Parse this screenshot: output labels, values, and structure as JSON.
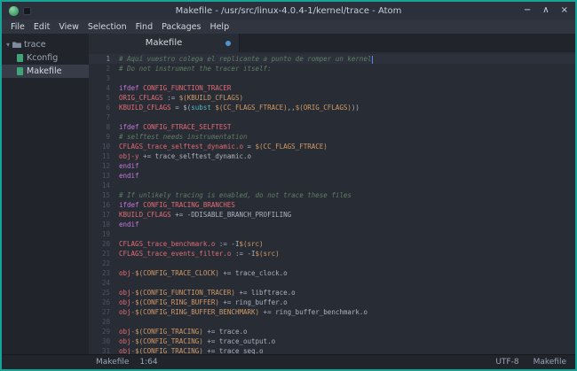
{
  "window": {
    "title": "Makefile - /usr/src/linux-4.0.4-1/kernel/trace - Atom",
    "controls": [
      {
        "name": "minimize",
        "glyph": "−"
      },
      {
        "name": "maximize",
        "glyph": "∧"
      },
      {
        "name": "close",
        "glyph": "×"
      }
    ]
  },
  "menu": {
    "items": [
      "File",
      "Edit",
      "View",
      "Selection",
      "Find",
      "Packages",
      "Help"
    ]
  },
  "sidebar": {
    "root": "trace",
    "files": [
      "Kconfig",
      "Makefile"
    ],
    "active_file": "Makefile"
  },
  "tabs": [
    {
      "label": "Makefile",
      "modified": true
    }
  ],
  "statusbar": {
    "file": "Makefile",
    "position": "1:64",
    "encoding": "UTF-8",
    "grammar": "Makefile"
  },
  "colors": {
    "frame": "#17a398",
    "editor_bg": "#282c34",
    "panel_bg": "#21252b",
    "comment": "#5f7e63",
    "keyword": "#c678dd",
    "variable": "#e06c75",
    "interpolation": "#d19a66",
    "function": "#56b6c2",
    "text": "#abb2bf",
    "modified_dot": "#5294cf",
    "file_icon": "#3fa478"
  },
  "editor": {
    "lines": [
      {
        "n": 1,
        "cursor": true,
        "t": [
          [
            "cmt",
            "# Aquí vuestro colega el replicante a punto de romper un kernel"
          ]
        ]
      },
      {
        "n": 2,
        "t": [
          [
            "cmt",
            "# Do not instrument the tracer itself:"
          ]
        ]
      },
      {
        "n": 3,
        "t": []
      },
      {
        "n": 4,
        "t": [
          [
            "kw",
            "ifdef"
          ],
          [
            "txt",
            " "
          ],
          [
            "var",
            "CONFIG_FUNCTION_TRACER"
          ]
        ]
      },
      {
        "n": 5,
        "t": [
          [
            "var",
            "ORIG_CFLAGS"
          ],
          [
            "txt",
            " := "
          ],
          [
            "interp",
            "$(KBUILD_CFLAGS)"
          ]
        ]
      },
      {
        "n": 6,
        "t": [
          [
            "var",
            "KBUILD_CFLAGS"
          ],
          [
            "txt",
            " = $("
          ],
          [
            "fn",
            "subst"
          ],
          [
            "txt",
            " "
          ],
          [
            "interp",
            "$(CC_FLAGS_FTRACE)"
          ],
          [
            "txt",
            ",,"
          ],
          [
            "interp",
            "$(ORIG_CFLAGS)"
          ],
          [
            "txt",
            "))"
          ]
        ]
      },
      {
        "n": 7,
        "t": []
      },
      {
        "n": 8,
        "t": [
          [
            "kw",
            "ifdef"
          ],
          [
            "txt",
            " "
          ],
          [
            "var",
            "CONFIG_FTRACE_SELFTEST"
          ]
        ]
      },
      {
        "n": 9,
        "t": [
          [
            "cmt",
            "# selftest needs instrumentation"
          ]
        ]
      },
      {
        "n": 10,
        "t": [
          [
            "var",
            "CFLAGS_trace_selftest_dynamic.o"
          ],
          [
            "txt",
            " = "
          ],
          [
            "interp",
            "$(CC_FLAGS_FTRACE)"
          ]
        ]
      },
      {
        "n": 11,
        "t": [
          [
            "var",
            "obj-y"
          ],
          [
            "txt",
            " += trace_selftest_dynamic.o"
          ]
        ]
      },
      {
        "n": 12,
        "t": [
          [
            "kw",
            "endif"
          ]
        ]
      },
      {
        "n": 13,
        "t": [
          [
            "kw",
            "endif"
          ]
        ]
      },
      {
        "n": 14,
        "t": []
      },
      {
        "n": 15,
        "t": [
          [
            "cmt",
            "# If unlikely tracing is enabled, do not trace these files"
          ]
        ]
      },
      {
        "n": 16,
        "t": [
          [
            "kw",
            "ifdef"
          ],
          [
            "txt",
            " "
          ],
          [
            "var",
            "CONFIG_TRACING_BRANCHES"
          ]
        ]
      },
      {
        "n": 17,
        "t": [
          [
            "var",
            "KBUILD_CFLAGS"
          ],
          [
            "txt",
            " += -DDISABLE_BRANCH_PROFILING"
          ]
        ]
      },
      {
        "n": 18,
        "t": [
          [
            "kw",
            "endif"
          ]
        ]
      },
      {
        "n": 19,
        "t": []
      },
      {
        "n": 20,
        "t": [
          [
            "var",
            "CFLAGS_trace_benchmark.o"
          ],
          [
            "txt",
            " := -I"
          ],
          [
            "interp",
            "$(src)"
          ]
        ]
      },
      {
        "n": 21,
        "t": [
          [
            "var",
            "CFLAGS_trace_events_filter.o"
          ],
          [
            "txt",
            " := -I"
          ],
          [
            "interp",
            "$(src)"
          ]
        ]
      },
      {
        "n": 22,
        "t": []
      },
      {
        "n": 23,
        "t": [
          [
            "var",
            "obj-"
          ],
          [
            "interp",
            "$(CONFIG_TRACE_CLOCK)"
          ],
          [
            "txt",
            " += trace_clock.o"
          ]
        ]
      },
      {
        "n": 24,
        "t": []
      },
      {
        "n": 25,
        "t": [
          [
            "var",
            "obj-"
          ],
          [
            "interp",
            "$(CONFIG_FUNCTION_TRACER)"
          ],
          [
            "txt",
            " += libftrace.o"
          ]
        ]
      },
      {
        "n": 26,
        "t": [
          [
            "var",
            "obj-"
          ],
          [
            "interp",
            "$(CONFIG_RING_BUFFER)"
          ],
          [
            "txt",
            " += ring_buffer.o"
          ]
        ]
      },
      {
        "n": 27,
        "t": [
          [
            "var",
            "obj-"
          ],
          [
            "interp",
            "$(CONFIG_RING_BUFFER_BENCHMARK)"
          ],
          [
            "txt",
            " += ring_buffer_benchmark.o"
          ]
        ]
      },
      {
        "n": 28,
        "t": []
      },
      {
        "n": 29,
        "t": [
          [
            "var",
            "obj-"
          ],
          [
            "interp",
            "$(CONFIG_TRACING)"
          ],
          [
            "txt",
            " += trace.o"
          ]
        ]
      },
      {
        "n": 30,
        "t": [
          [
            "var",
            "obj-"
          ],
          [
            "interp",
            "$(CONFIG_TRACING)"
          ],
          [
            "txt",
            " += trace_output.o"
          ]
        ]
      },
      {
        "n": 31,
        "t": [
          [
            "var",
            "obj-"
          ],
          [
            "interp",
            "$(CONFIG_TRACING)"
          ],
          [
            "txt",
            " += trace_seq.o"
          ]
        ]
      }
    ]
  }
}
